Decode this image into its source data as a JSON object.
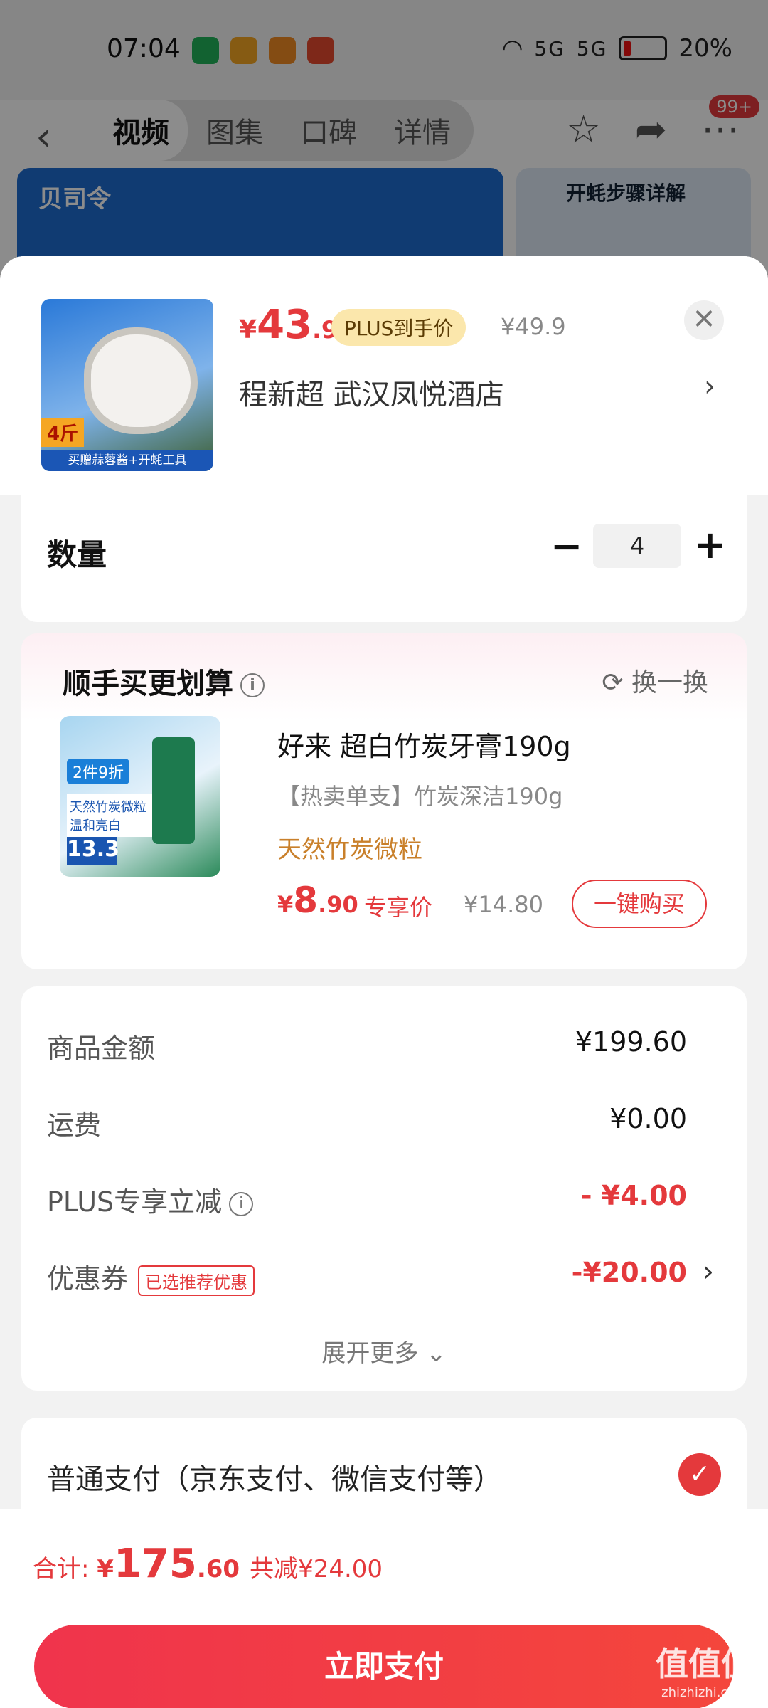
{
  "status_bar": {
    "time": "07:04",
    "signal1": "5G",
    "signal2": "5G",
    "battery": "20%"
  },
  "nav": {
    "tabs": [
      {
        "label": "视频",
        "active": true
      },
      {
        "label": "图集",
        "active": false
      },
      {
        "label": "口碑",
        "active": false
      },
      {
        "label": "详情",
        "active": false
      }
    ],
    "badge": "99+"
  },
  "banner": {
    "brand": "贝司令",
    "right_title": "开蚝步骤详解"
  },
  "product": {
    "price_currency": "¥",
    "price_int": "43",
    "price_dec": ".9",
    "plus_tag": "PLUS到手价",
    "orig_price": "¥49.9",
    "address": "程新超  武汉凤悦酒店",
    "thumb_tag": "4斤",
    "thumb_strip": "买赠蒜蓉酱+开蚝工具"
  },
  "quantity": {
    "label": "数量",
    "value": "4"
  },
  "upsell": {
    "title": "顺手买更划算",
    "swap": "换一换",
    "name": "好来 超白竹炭牙膏190g",
    "subtitle": "【热卖单支】竹炭深洁190g",
    "feature": "天然竹炭微粒",
    "price_currency": "¥",
    "price_int": "8",
    "price_dec": ".90",
    "exclusive_label": "专享价",
    "orig_price": "¥14.80",
    "buy_label": "一键购买",
    "img_tag1": "2件9折",
    "img_tag2": "天然竹炭微粒 温和亮白",
    "img_tag3": "13.3"
  },
  "summary": {
    "rows": [
      {
        "label": "商品金额",
        "value": "¥199.60"
      },
      {
        "label": "运费",
        "value": "¥0.00"
      },
      {
        "label": "PLUS专享立减",
        "value": "- ¥4.00"
      },
      {
        "label": "优惠券",
        "value": "-¥20.00",
        "tag": "已选推荐优惠"
      }
    ],
    "expand": "展开更多 ⌄"
  },
  "payment": {
    "label": "普通支付（京东支付、微信支付等）"
  },
  "total": {
    "label": "合计: ",
    "currency": "¥",
    "int": "175",
    "dec": ".60",
    "saved": "共减¥24.00"
  },
  "pay_button": "立即支付",
  "watermark": {
    "big": "值值值",
    "small": "zhizhizhi.com"
  }
}
